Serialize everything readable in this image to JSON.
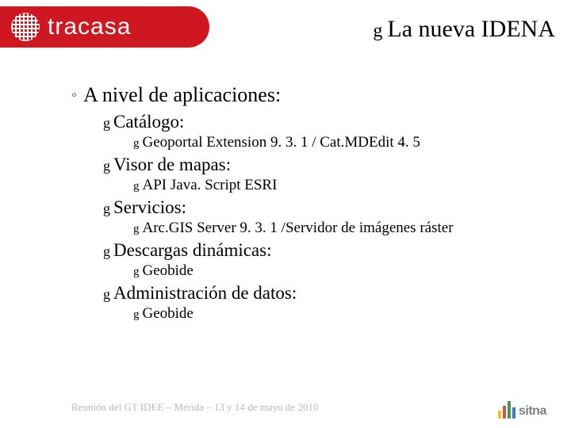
{
  "logo": {
    "text": "tracasa"
  },
  "title": {
    "bullet": "g",
    "text": "La nueva IDENA"
  },
  "heading": {
    "marker": "◦",
    "text": "A nivel de aplicaciones:"
  },
  "items": [
    {
      "label": "Catálogo:",
      "detail": "Geoportal Extension 9. 3. 1 / Cat.MDEdit 4. 5"
    },
    {
      "label": "Visor de mapas:",
      "detail": "API Java. Script ESRI"
    },
    {
      "label": "Servicios:",
      "detail": "Arc.GIS Server 9. 3. 1 /Servidor de imágenes ráster"
    },
    {
      "label": "Descargas dinámicas:",
      "detail": "Geobide"
    },
    {
      "label": "Administración de datos:",
      "detail": "Geobide"
    }
  ],
  "bullets": {
    "script": "g"
  },
  "footer": "Reunión del GT IDEE – Mérida – 13 y 14 de mayo de 2010",
  "sitna": {
    "text": "sitna"
  }
}
